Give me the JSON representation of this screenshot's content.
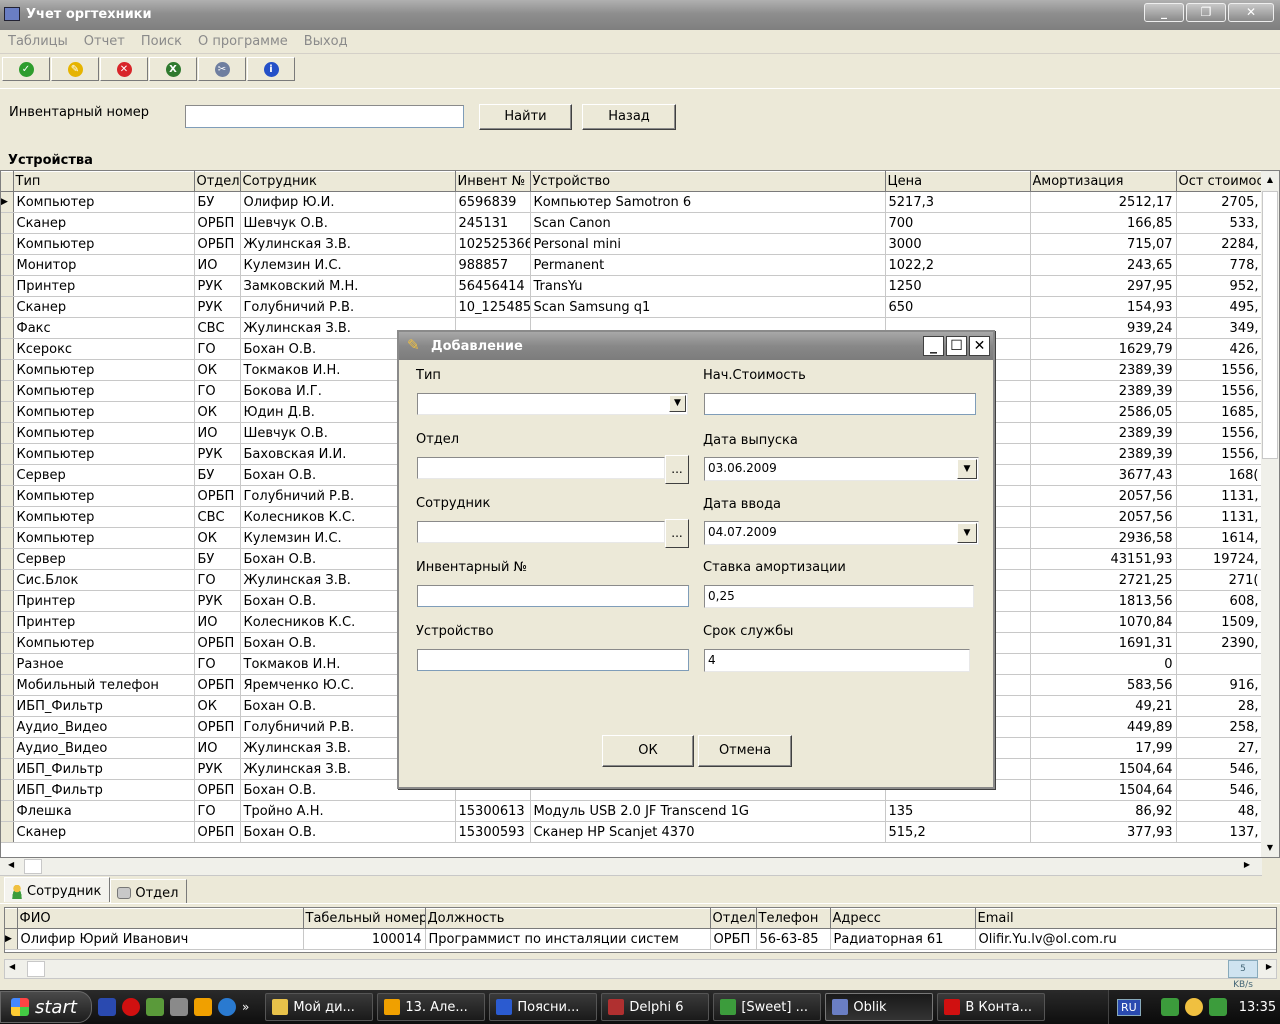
{
  "window": {
    "title": "Учет оргтехники"
  },
  "menu": [
    "Таблицы",
    "Отчет",
    "Поиск",
    "О программе",
    "Выход"
  ],
  "toolbar": [
    {
      "name": "confirm-icon",
      "color": "#2e9d2e",
      "glyph": "✓"
    },
    {
      "name": "edit-pencil-icon",
      "color": "#e6b400",
      "glyph": "✎"
    },
    {
      "name": "delete-icon",
      "color": "#d8252a",
      "glyph": "✕"
    },
    {
      "name": "excel-export-icon",
      "color": "#2f7a2f",
      "glyph": "X"
    },
    {
      "name": "tools-icon",
      "color": "#6f7fa0",
      "glyph": "✂"
    },
    {
      "name": "info-icon",
      "color": "#2450c8",
      "glyph": "i"
    }
  ],
  "search": {
    "label": "Инвентарный номер",
    "value": "",
    "find_button": "Найти",
    "back_button": "Назад"
  },
  "devices": {
    "title": "Устройства",
    "columns": [
      "Тип",
      "Отдел",
      "Сотрудник",
      "Инвент №",
      "Устройство",
      "Цена",
      "Амортизация",
      "Ост стоимос"
    ],
    "rows": [
      [
        "Компьютер",
        "БУ",
        "Олифир Ю.И.",
        "6596839",
        "Компьютер Samotron 6",
        "5217,3",
        "2512,17",
        "2705,"
      ],
      [
        "Сканер",
        "ОРБП",
        "Шевчук О.В.",
        "245131",
        "Scan Canon",
        "700",
        "166,85",
        "533,"
      ],
      [
        "Компьютер",
        "ОРБП",
        "Жулинская З.В.",
        "102525366",
        "Personal mini",
        "3000",
        "715,07",
        "2284,"
      ],
      [
        "Монитор",
        "ИО",
        "Кулемзин И.С.",
        "988857",
        "Permanent",
        "1022,2",
        "243,65",
        "778,"
      ],
      [
        "Принтер",
        "РУК",
        "Замковский М.Н.",
        "56456414",
        "TransYu",
        "1250",
        "297,95",
        "952,"
      ],
      [
        "Сканер",
        "РУК",
        "Голубничий Р.В.",
        "10_125485",
        "Scan Samsung q1",
        "650",
        "154,93",
        "495,"
      ],
      [
        "Факс",
        "СВС",
        "Жулинская З.В.",
        "",
        "",
        "",
        "939,24",
        "349,"
      ],
      [
        "Ксерокс",
        "ГО",
        "Бохан О.В.",
        "",
        "",
        "",
        "1629,79",
        "426,"
      ],
      [
        "Компьютер",
        "ОК",
        "Токмаков И.Н.",
        "",
        "",
        "",
        "2389,39",
        "1556,"
      ],
      [
        "Компьютер",
        "ГО",
        "Бокова И.Г.",
        "",
        "",
        "",
        "2389,39",
        "1556,"
      ],
      [
        "Компьютер",
        "ОК",
        "Юдин Д.В.",
        "",
        "",
        "",
        "2586,05",
        "1685,"
      ],
      [
        "Компьютер",
        "ИО",
        "Шевчук О.В.",
        "",
        "",
        "",
        "2389,39",
        "1556,"
      ],
      [
        "Компьютер",
        "РУК",
        "Баховская И.И.",
        "",
        "",
        "",
        "2389,39",
        "1556,"
      ],
      [
        "Сервер",
        "БУ",
        "Бохан О.В.",
        "",
        "",
        "",
        "3677,43",
        "168("
      ],
      [
        "Компьютер",
        "ОРБП",
        "Голубничий Р.В.",
        "",
        "",
        "",
        "2057,56",
        "1131,"
      ],
      [
        "Компьютер",
        "СВС",
        "Колесников К.С.",
        "",
        "",
        "",
        "2057,56",
        "1131,"
      ],
      [
        "Компьютер",
        "ОК",
        "Кулемзин И.С.",
        "",
        "",
        "",
        "2936,58",
        "1614,"
      ],
      [
        "Сервер",
        "БУ",
        "Бохан О.В.",
        "",
        "",
        "",
        "43151,93",
        "19724,"
      ],
      [
        "Сис.Блок",
        "ГО",
        "Жулинская З.В.",
        "",
        "",
        "",
        "2721,25",
        "271("
      ],
      [
        "Принтер",
        "РУК",
        "Бохан О.В.",
        "",
        "",
        "",
        "1813,56",
        "608,"
      ],
      [
        "Принтер",
        "ИО",
        "Колесников К.С.",
        "",
        "",
        "",
        "1070,84",
        "1509,"
      ],
      [
        "Компьютер",
        "ОРБП",
        "Бохан О.В.",
        "",
        "",
        "",
        "1691,31",
        "2390,"
      ],
      [
        "Разное",
        "ГО",
        "Токмаков И.Н.",
        "",
        "",
        "",
        "0",
        ""
      ],
      [
        "Мобильный телефон",
        "ОРБП",
        "Яремченко Ю.С.",
        "",
        "",
        "",
        "583,56",
        "916,"
      ],
      [
        "ИБП_Фильтр",
        "ОК",
        "Бохан О.В.",
        "",
        "",
        "",
        "49,21",
        "28,"
      ],
      [
        "Аудио_Видео",
        "ОРБП",
        "Голубничий Р.В.",
        "",
        "",
        "",
        "449,89",
        "258,"
      ],
      [
        "Аудио_Видео",
        "ИО",
        "Жулинская З.В.",
        "",
        "",
        "",
        "17,99",
        "27,"
      ],
      [
        "ИБП_Фильтр",
        "РУК",
        "Жулинская З.В.",
        "",
        "",
        "",
        "1504,64",
        "546,"
      ],
      [
        "ИБП_Фильтр",
        "ОРБП",
        "Бохан О.В.",
        "",
        "",
        "",
        "1504,64",
        "546,"
      ],
      [
        "Флешка",
        "ГО",
        "Тройно А.Н.",
        "15300613",
        "Модуль USB 2.0 JF Transcend 1G",
        "135",
        "86,92",
        "48,"
      ],
      [
        "Сканер",
        "ОРБП",
        "Бохан О.В.",
        "15300593",
        "Сканер HP Scanjet 4370",
        "515,2",
        "377,93",
        "137,"
      ]
    ]
  },
  "tabs": [
    {
      "label": "Сотрудник",
      "active": true
    },
    {
      "label": "Отдел",
      "active": false
    }
  ],
  "employees": {
    "columns": [
      "ФИО",
      "Табельный номер",
      "Должность",
      "Отдел",
      "Телефон",
      "Адресс",
      "Email"
    ],
    "rows": [
      [
        "Олифир Юрий Иванович",
        "100014",
        "Программист по инсталяции систем",
        "ОРБП",
        "56-63-85",
        "Радиаторная 61",
        "Olifir.Yu.lv@ol.com.ru"
      ]
    ]
  },
  "net_speed": "5 KB/s",
  "dialog": {
    "title": "Добавление",
    "type_label": "Тип",
    "type_value": "",
    "dept_label": "Отдел",
    "dept_value": "",
    "employee_label": "Сотрудник",
    "employee_value": "",
    "inv_label": "Инвентарный №",
    "inv_value": "",
    "device_label": "Устройство",
    "device_value": "",
    "cost_label": "Нач.Стоимость",
    "cost_value": "",
    "release_label": "Дата выпуска",
    "release_value": "03.06.2009",
    "input_label": "Дата ввода",
    "input_value": "04.07.2009",
    "rate_label": "Ставка амортизации",
    "rate_value": "0,25",
    "term_label": "Срок службы",
    "term_value": "4",
    "ok": "ОК",
    "cancel": "Отмена",
    "ellipsis": "..."
  },
  "taskbar": {
    "start": "start",
    "tasks": [
      {
        "label": "Мой ди...",
        "color": "#e8c24a"
      },
      {
        "label": "13. Але...",
        "color": "#f0a000"
      },
      {
        "label": "Поясни...",
        "color": "#2b5bd0"
      },
      {
        "label": "Delphi 6",
        "color": "#b03030"
      },
      {
        "label": "[Sweet] ...",
        "color": "#3c9c3c"
      },
      {
        "label": "Oblik",
        "color": "#6a7ec4",
        "active": true
      },
      {
        "label": "В Конта...",
        "color": "#d01010"
      }
    ],
    "lang": "RU",
    "clock": "13:35"
  }
}
